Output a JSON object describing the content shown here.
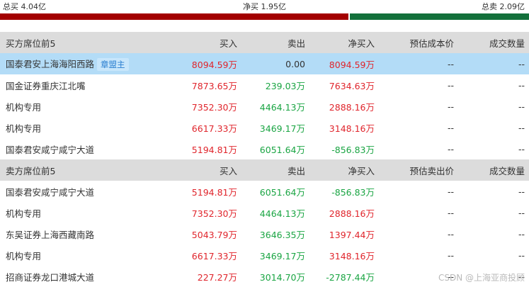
{
  "summary": {
    "total_buy": "总买 4.04亿",
    "net_buy": "净买 1.95亿",
    "total_sell": "总卖 2.09亿"
  },
  "colors": {
    "rise": "#e0252c",
    "fall": "#1aa543",
    "buy_bar": "#a30000",
    "sell_bar": "#13703b",
    "highlight": "#b3dcf7"
  },
  "buy_table": {
    "headers": [
      "买方席位前5",
      "买入",
      "卖出",
      "净买入",
      "预估成本价",
      "成交数量"
    ],
    "rows": [
      {
        "seat": "国泰君安上海海阳西路",
        "tag": "章盟主",
        "buy": "8094.59万",
        "sell": "0.00",
        "net": "8094.59万",
        "est": "--",
        "vol": "--"
      },
      {
        "seat": "国金证券重庆江北嘴",
        "tag": "",
        "buy": "7873.65万",
        "sell": "239.03万",
        "net": "7634.63万",
        "est": "--",
        "vol": "--"
      },
      {
        "seat": "机构专用",
        "tag": "",
        "buy": "7352.30万",
        "sell": "4464.13万",
        "net": "2888.16万",
        "est": "--",
        "vol": "--"
      },
      {
        "seat": "机构专用",
        "tag": "",
        "buy": "6617.33万",
        "sell": "3469.17万",
        "net": "3148.16万",
        "est": "--",
        "vol": "--"
      },
      {
        "seat": "国泰君安咸宁咸宁大道",
        "tag": "",
        "buy": "5194.81万",
        "sell": "6051.64万",
        "net": "-856.83万",
        "est": "--",
        "vol": "--"
      }
    ]
  },
  "sell_table": {
    "headers": [
      "卖方席位前5",
      "买入",
      "卖出",
      "净买入",
      "预估卖出价",
      "成交数量"
    ],
    "rows": [
      {
        "seat": "国泰君安咸宁咸宁大道",
        "tag": "",
        "buy": "5194.81万",
        "sell": "6051.64万",
        "net": "-856.83万",
        "est": "--",
        "vol": "--"
      },
      {
        "seat": "机构专用",
        "tag": "",
        "buy": "7352.30万",
        "sell": "4464.13万",
        "net": "2888.16万",
        "est": "--",
        "vol": "--"
      },
      {
        "seat": "东吴证券上海西藏南路",
        "tag": "",
        "buy": "5043.79万",
        "sell": "3646.35万",
        "net": "1397.44万",
        "est": "--",
        "vol": "--"
      },
      {
        "seat": "机构专用",
        "tag": "",
        "buy": "6617.33万",
        "sell": "3469.17万",
        "net": "3148.16万",
        "est": "--",
        "vol": "--"
      },
      {
        "seat": "招商证券龙口港城大道",
        "tag": "",
        "buy": "227.27万",
        "sell": "3014.70万",
        "net": "-2787.44万",
        "est": "--",
        "vol": "--"
      }
    ]
  },
  "watermark": "CSDN @上海亚商投顾"
}
